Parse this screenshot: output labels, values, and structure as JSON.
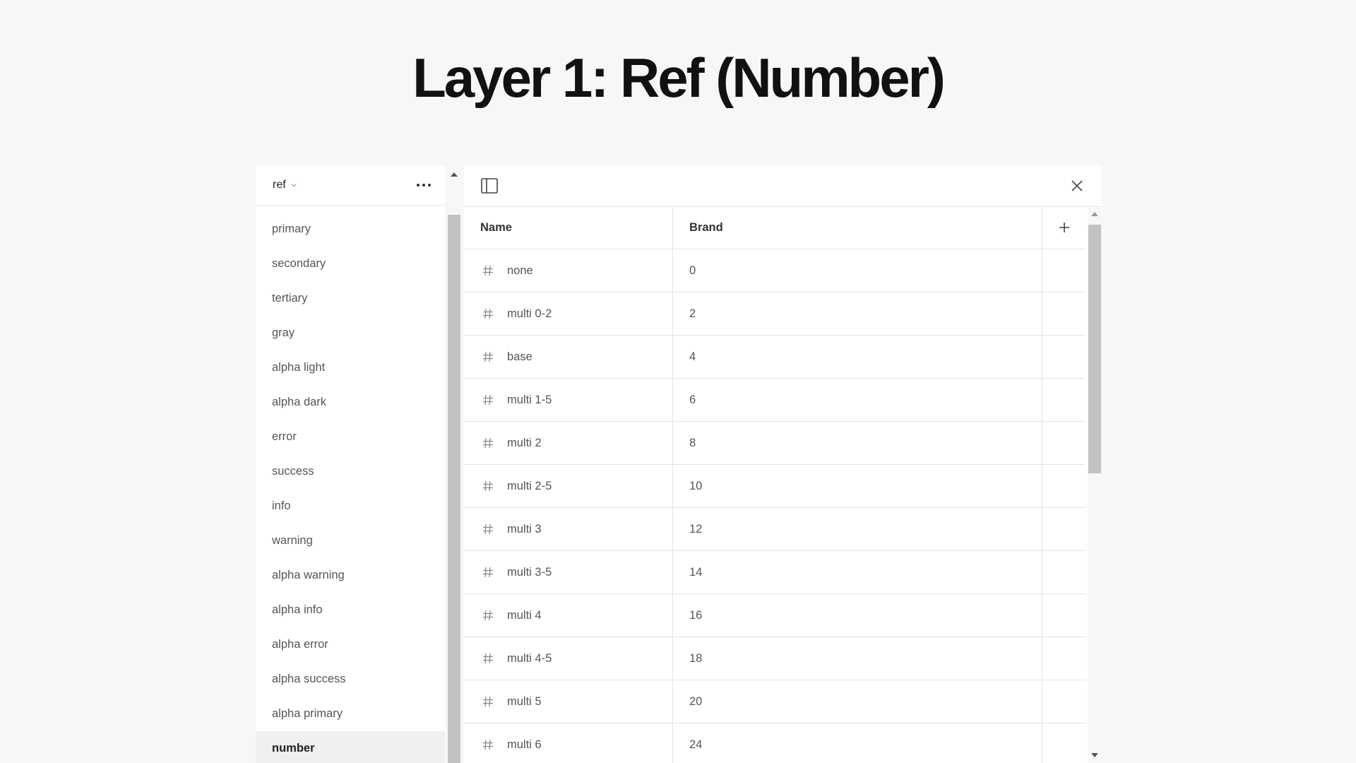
{
  "page": {
    "title": "Layer 1: Ref (Number)"
  },
  "sidebar": {
    "collection": "ref",
    "groups": [
      "primary",
      "secondary",
      "tertiary",
      "gray",
      "alpha light",
      "alpha dark",
      "error",
      "success",
      "info",
      "warning",
      "alpha warning",
      "alpha info",
      "alpha error",
      "alpha success",
      "alpha primary",
      "number"
    ],
    "active_group": "number"
  },
  "table": {
    "headers": {
      "name": "Name",
      "mode": "Brand"
    },
    "rows": [
      {
        "name": "none",
        "value": "0"
      },
      {
        "name": "multi 0-2",
        "value": "2"
      },
      {
        "name": "base",
        "value": "4"
      },
      {
        "name": "multi 1-5",
        "value": "6"
      },
      {
        "name": "multi 2",
        "value": "8"
      },
      {
        "name": "multi 2-5",
        "value": "10"
      },
      {
        "name": "multi 3",
        "value": "12"
      },
      {
        "name": "multi 3-5",
        "value": "14"
      },
      {
        "name": "multi 4",
        "value": "16"
      },
      {
        "name": "multi 4-5",
        "value": "18"
      },
      {
        "name": "multi 5",
        "value": "20"
      },
      {
        "name": "multi 6",
        "value": "24"
      }
    ]
  },
  "icons": {
    "collection_dropdown": "chevron-down-icon",
    "more": "more-horizontal-icon",
    "panel_toggle": "sidebar-toggle-icon",
    "close": "close-icon",
    "row_type": "hash-icon",
    "add_column": "plus-icon"
  }
}
